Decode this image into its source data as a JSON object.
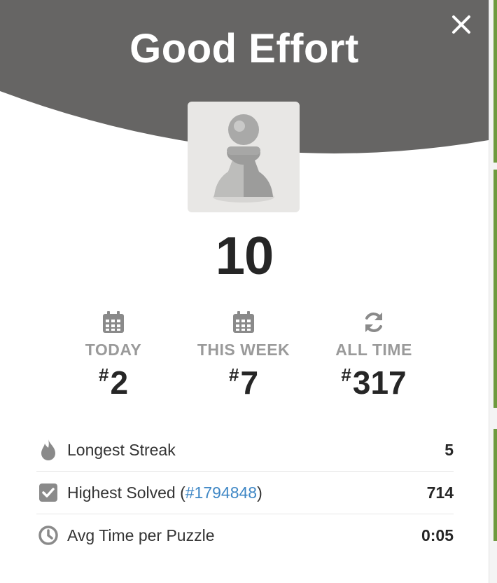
{
  "modal": {
    "title": "Good Effort",
    "close_label": "Close",
    "score": "10",
    "colors": {
      "header": "#666564",
      "accent_link": "#3f87c5",
      "side_accent": "#6e9a3e"
    }
  },
  "ranks": [
    {
      "icon": "calendar-icon",
      "label": "TODAY",
      "hash": "#",
      "value": "2"
    },
    {
      "icon": "calendar-icon",
      "label": "THIS WEEK",
      "hash": "#",
      "value": "7"
    },
    {
      "icon": "refresh-icon",
      "label": "ALL TIME",
      "hash": "#",
      "value": "317"
    }
  ],
  "stats": [
    {
      "icon": "flame-icon",
      "label": "Longest Streak",
      "value": "5"
    },
    {
      "icon": "checkbox-icon",
      "label_prefix": "Highest Solved (",
      "link": "#1794848",
      "label_suffix": ")",
      "value": "714"
    },
    {
      "icon": "clock-icon",
      "label": "Avg Time per Puzzle",
      "value": "0:05"
    }
  ]
}
